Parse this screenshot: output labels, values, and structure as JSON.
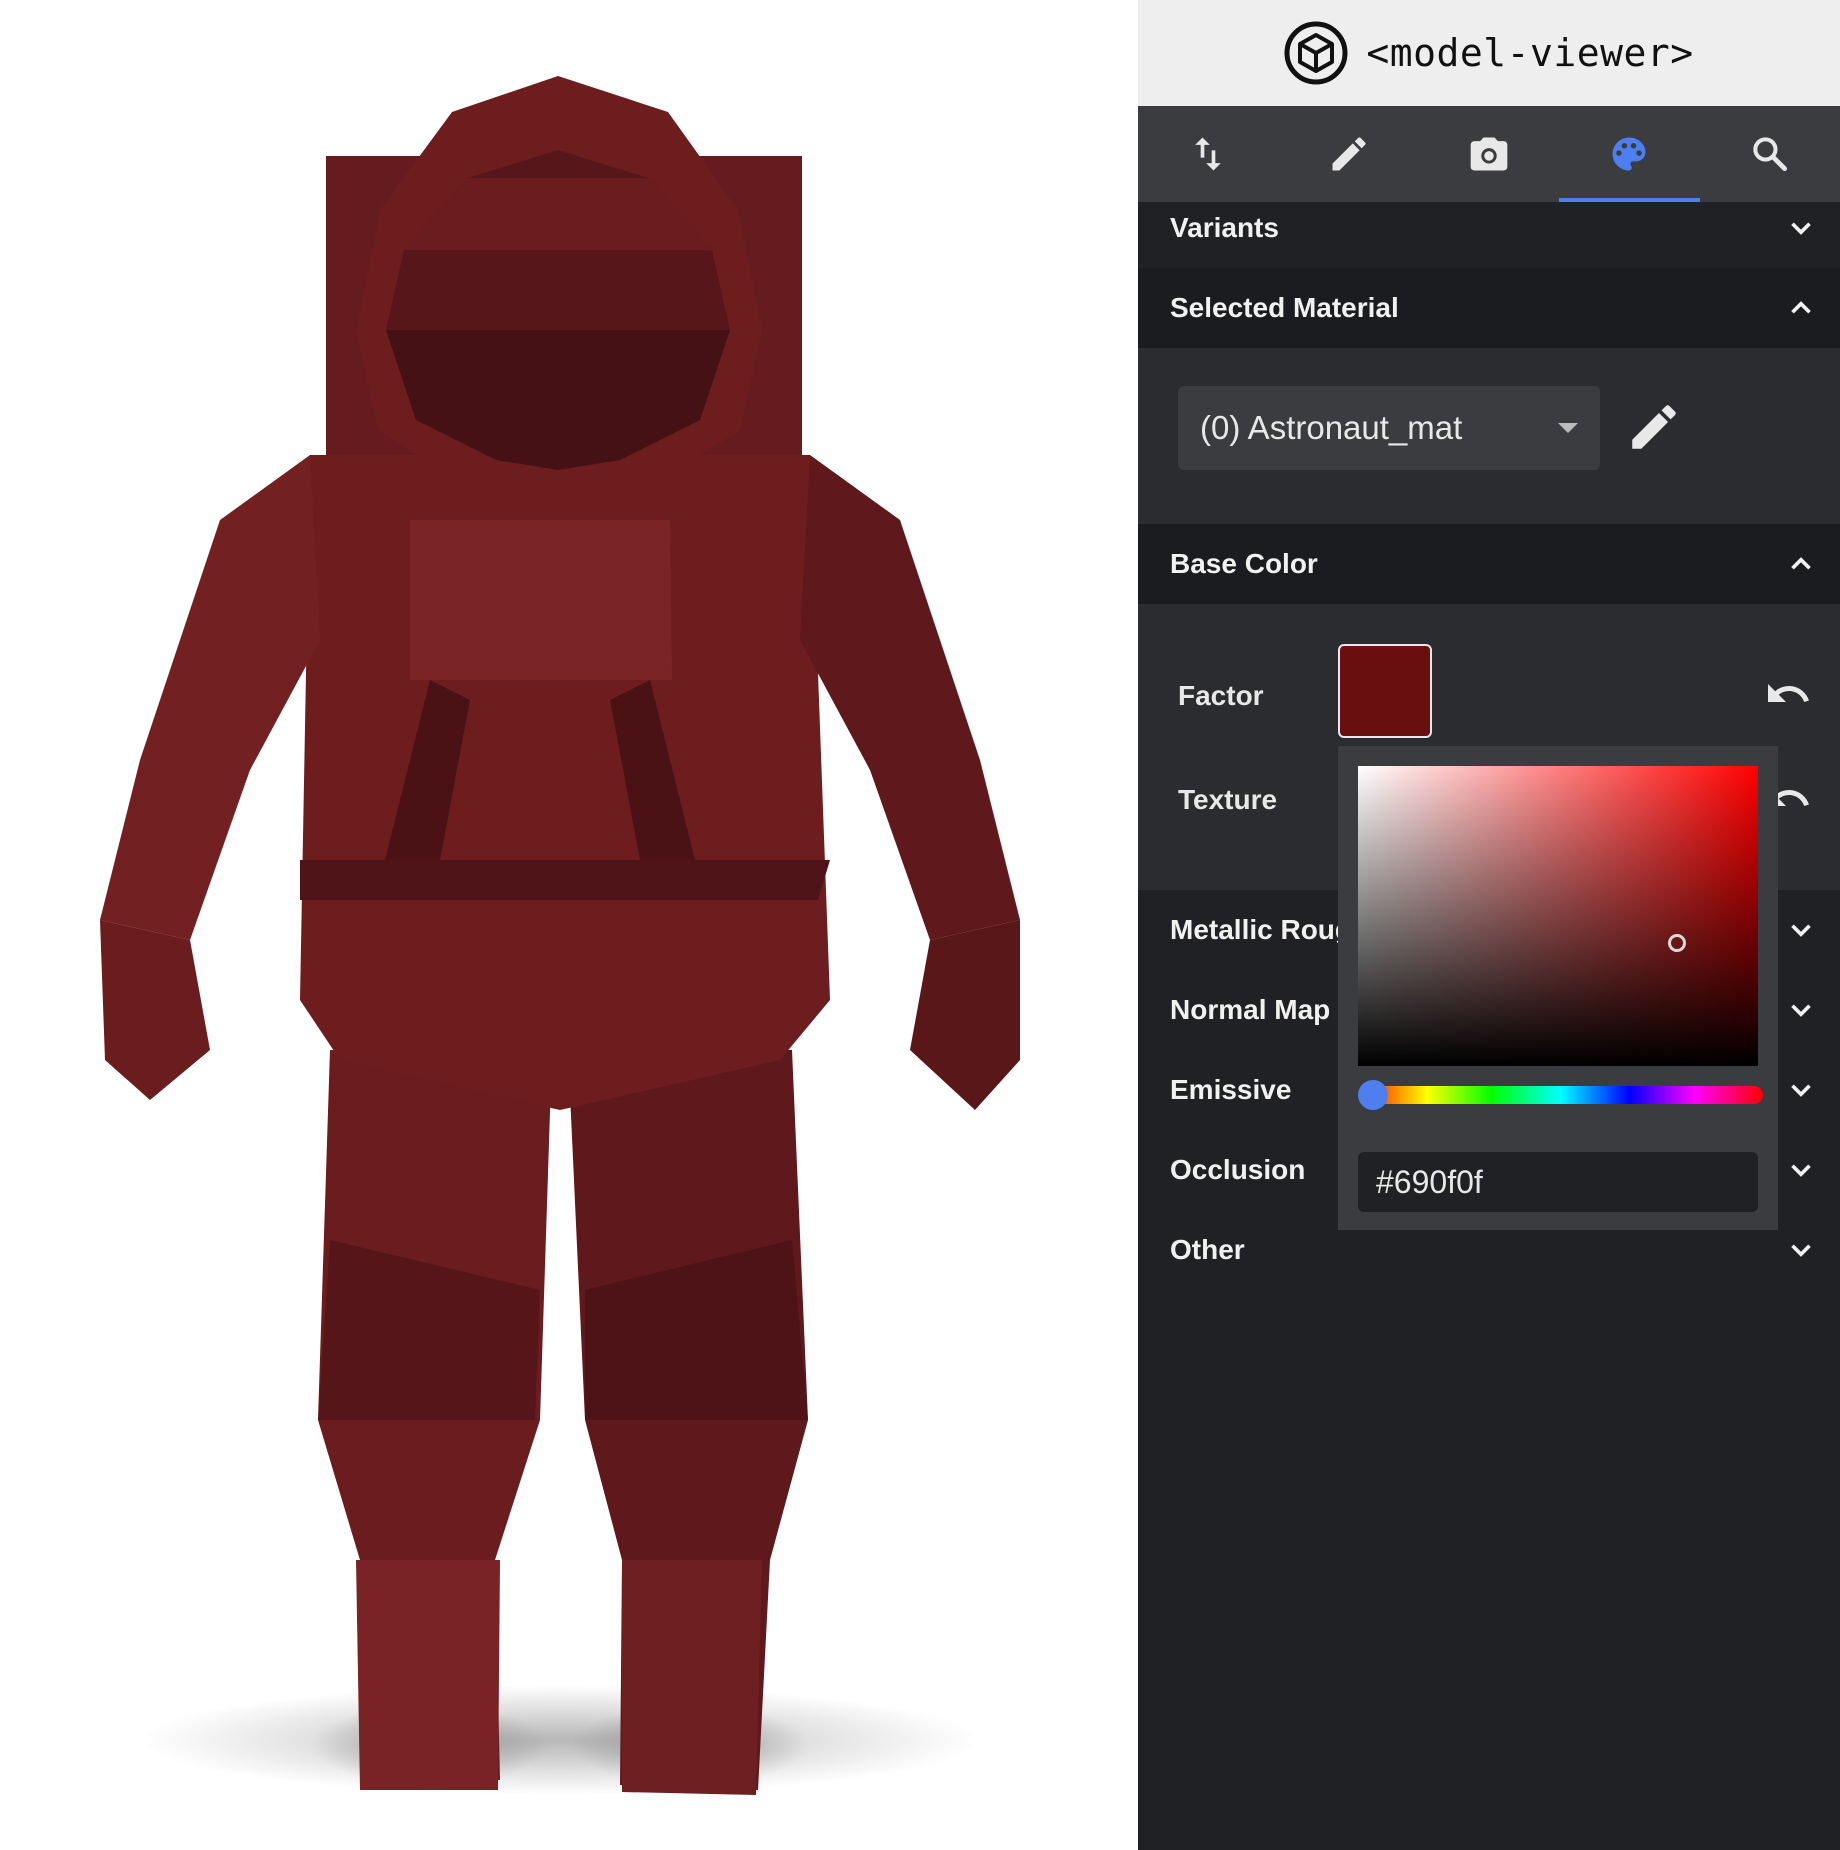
{
  "app": {
    "title": "<model-viewer>",
    "logo_icon": "model-viewer-cube-logo"
  },
  "tabs": [
    {
      "icon": "sort-arrows-icon",
      "active": false
    },
    {
      "icon": "pencil-icon",
      "active": false
    },
    {
      "icon": "camera-icon",
      "active": false
    },
    {
      "icon": "palette-icon",
      "active": true
    },
    {
      "icon": "search-icon",
      "active": false
    }
  ],
  "sections": {
    "variants": "Variants",
    "selected_material": "Selected Material",
    "base_color": "Base Color",
    "metallic_roughness": "Metallic Roughness",
    "normal_map": "Normal Map",
    "emissive": "Emissive",
    "occlusion": "Occlusion",
    "other": "Other"
  },
  "material_select": {
    "value": "(0) Astronaut_mat"
  },
  "base_color": {
    "factor_label": "Factor",
    "texture_label": "Texture",
    "swatch_color": "#690f0f"
  },
  "color_picker": {
    "hex_value": "#690f0f",
    "base_hue": "#ff0000",
    "hue_thumb": "#4e7ff0"
  },
  "colors": {
    "accent": "#4e7ff0",
    "model": "#6e1d1f"
  }
}
